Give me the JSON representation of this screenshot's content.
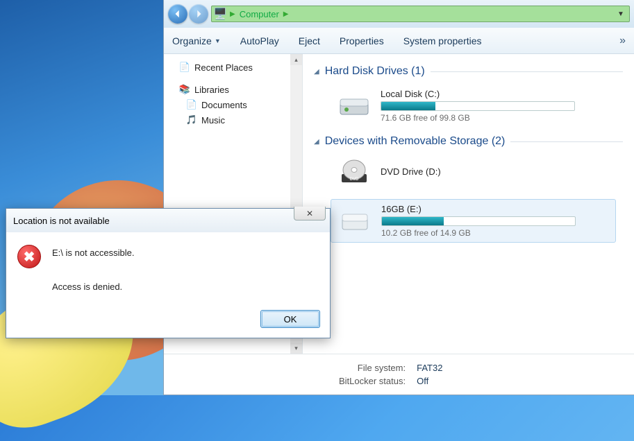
{
  "breadcrumb": {
    "root": "Computer"
  },
  "toolbar": {
    "organize": "Organize",
    "autoplay": "AutoPlay",
    "eject": "Eject",
    "properties": "Properties",
    "system_properties": "System properties",
    "overflow": "»"
  },
  "sidebar": {
    "recent_places": "Recent Places",
    "libraries": "Libraries",
    "documents": "Documents",
    "music": "Music"
  },
  "categories": {
    "hdd": "Hard Disk Drives (1)",
    "removable": "Devices with Removable Storage (2)"
  },
  "drives": {
    "c": {
      "name": "Local Disk (C:)",
      "free": "71.6 GB free of 99.8 GB",
      "fill_pct": 28
    },
    "d": {
      "name": "DVD Drive (D:)"
    },
    "e": {
      "name": "16GB (E:)",
      "free": "10.2 GB free of 14.9 GB",
      "fill_pct": 32
    }
  },
  "details": {
    "fs_label": "File system:",
    "fs_value": "FAT32",
    "bitlocker_label": "BitLocker status:",
    "bitlocker_value": "Off"
  },
  "dialog": {
    "title": "Location is not available",
    "line1": "E:\\ is not accessible.",
    "line2": "Access is denied.",
    "ok": "OK",
    "close_glyph": "✕"
  }
}
